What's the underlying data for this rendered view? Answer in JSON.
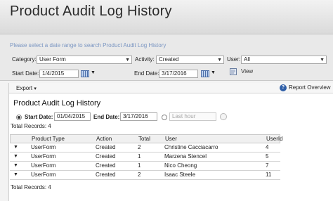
{
  "header": {
    "title": "Product Audit Log History"
  },
  "filters": {
    "instructions": "Please select a date range to search Product Audit Log History",
    "category_label": "Category:",
    "category_value": "User Form",
    "activity_label": "Activity:",
    "activity_value": "Created",
    "user_label": "User:",
    "user_value": "All",
    "start_label": "Start Date:",
    "start_value": "1/4/2015",
    "end_label": "End Date:",
    "end_value": "3/17/2016",
    "view_label": "View"
  },
  "toolbar": {
    "export_label": "Export",
    "overview_label": "Report Overview",
    "overview_icon": "help-icon"
  },
  "report": {
    "title": "Product Audit Log History",
    "start_label": "Start Date:",
    "start_value": "01/04/2015",
    "end_label": "End Date:",
    "end_value": "3/17/2016",
    "range_placeholder": "Last hour",
    "total_top": "Total Records: 4",
    "total_bottom": "Total Records: 4"
  },
  "table": {
    "columns": [
      "Product Type",
      "Action",
      "Total",
      "User",
      "UserId"
    ],
    "rows": [
      [
        "UserForm",
        "Created",
        "2",
        "Christine Cacciacarro",
        "4"
      ],
      [
        "UserForm",
        "Created",
        "1",
        "Marzena Stencel",
        "5"
      ],
      [
        "UserForm",
        "Created",
        "1",
        "Nico Cheong",
        "7"
      ],
      [
        "UserForm",
        "Created",
        "2",
        "Isaac Steele",
        "11"
      ]
    ]
  },
  "colors": {
    "accent": "#2f5fa8",
    "instructions": "#7b96c2"
  }
}
